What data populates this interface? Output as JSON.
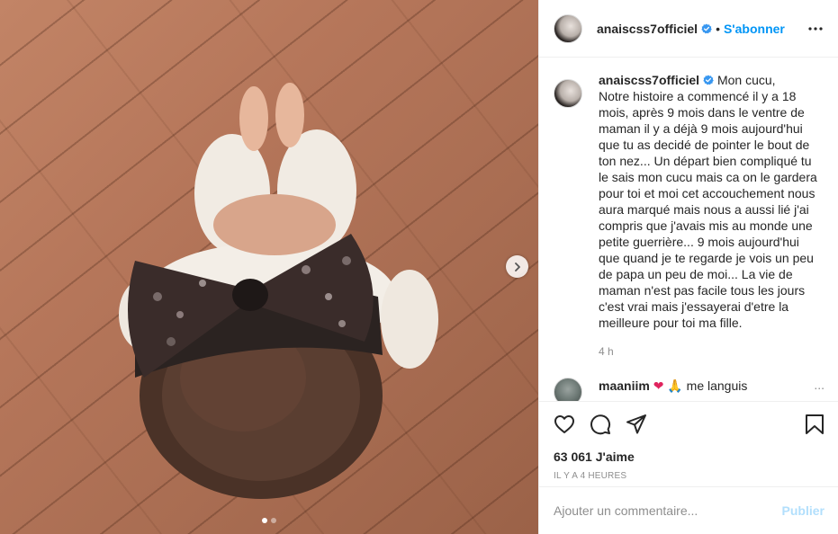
{
  "post": {
    "username": "anaiscss7officiel",
    "separator": "•",
    "follow_label": "S'abonner"
  },
  "caption": {
    "username": "anaiscss7officiel",
    "text": "Mon cucu,\nNotre histoire a commencé il y a 18 mois, après 9 mois dans le ventre de maman il y a déjà 9 mois aujourd'hui que tu as decidé de pointer le bout de ton nez... Un départ bien compliqué tu le sais mon cucu mais ca on le gardera pour toi et moi cet accouchement nous aura marqué mais nous a aussi lié j'ai compris que j'avais mis au monde une petite guerrière... 9 mois aujourd'hui que quand je te regarde je vois un peu de papa un peu de moi... La vie de maman n'est pas facile tous les jours c'est vrai mais j'essayerai d'etre la meilleure pour toi ma fille.",
    "time": "4 h"
  },
  "first_comment": {
    "username": "maaniim",
    "emoji": "❤",
    "emoji2": "🙏",
    "text": "me languis",
    "more": "..."
  },
  "actions": {
    "likes_count": "63 061",
    "likes_label": "J'aime",
    "posted": "Il y a 4 heures"
  },
  "comment_input": {
    "placeholder": "Ajouter un commentaire...",
    "publish_label": "Publier"
  },
  "carousel": {
    "current": 1,
    "total": 2
  },
  "icons": {
    "verified": "verified-badge-icon",
    "more": "more-options-icon",
    "like": "heart-icon",
    "comment": "comment-icon",
    "share": "share-icon",
    "save": "bookmark-icon",
    "next": "chevron-right-icon"
  },
  "colors": {
    "accent": "#0095f6",
    "publish_disabled": "#b2dffc",
    "text": "#262626",
    "muted": "#8e8e8e"
  }
}
